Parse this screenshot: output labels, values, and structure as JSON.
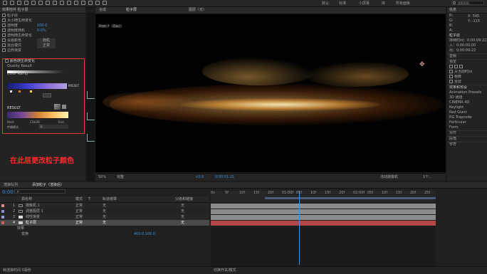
{
  "toolbar": {
    "right_items": [
      "默认",
      "标准",
      "小屏幕",
      "库",
      "所有面板"
    ],
    "search_placeholder": "搜索帮助"
  },
  "effect_panel": {
    "tab": "效果控件 粒子层",
    "rows": [
      "粒子层",
      "大小随生命变化",
      "透明度",
      "透明度随机",
      "透明随生命变化",
      "设置颜色",
      "混合模式",
      "边界渐变",
      "颜色随生命变化",
      "传输模式"
    ],
    "values": [
      "",
      "",
      "100.0",
      "0.0%",
      "",
      "随机",
      "正常",
      "",
      "",
      ""
    ],
    "group_title": "颜色随生命变化",
    "quality_label": "Quality Result",
    "color_ramp_label": "Color Ramp",
    "preset_label": "PRESET",
    "result_label": "RESULT",
    "start_label": "Start",
    "color_label": "COLOR",
    "end_label": "End",
    "mode_label": "传输模式",
    "mode_value": "无"
  },
  "annotation": {
    "text": "在此层更改粒子颜色"
  },
  "viewer": {
    "tabs": [
      "合成",
      "粒子层",
      "图层（无）"
    ],
    "comp_name": "添加粒子（渲染后）",
    "status_items": [
      "50%",
      "完整",
      "0:00:01:21",
      "活动摄像机",
      "1个...",
      "+0.0"
    ],
    "colors": {
      "glow": "#ffb347",
      "core": "#fff1b8",
      "bg": "#020202"
    }
  },
  "right_panel": {
    "title": "信息",
    "items": [
      "R:",
      "G:",
      "B:",
      "A:",
      "X: 595",
      "Y: -115",
      "粒子层",
      "持续时间：0:00:09:22",
      "入：0:00:00:00",
      "出：0:00:09:22",
      "音频",
      "预览",
      "效果和预设",
      "对齐",
      "段落",
      "字符"
    ],
    "checkbox_labels": [
      "从当前时间",
      "帧数",
      "全屏"
    ],
    "effects": [
      "Animation Presets",
      "3D 通道",
      "CINEMA 4D",
      "Keylight",
      "Red Giant",
      "RG Trapcode",
      "Particular",
      "Form"
    ]
  },
  "timeline": {
    "tabs": [
      "渲染队列",
      "添加粒子（渲染后）"
    ],
    "timecode": "0:00:01:21",
    "search_placeholder": "ρ.",
    "headers": [
      "源名称",
      "模式",
      "T",
      "轨道遮罩",
      "父级和链接"
    ],
    "ruler": [
      "0s",
      "5f",
      "10f",
      "15f",
      "20f",
      "01:00f",
      "05f",
      "10f",
      "15f",
      "20f",
      "02:00f",
      "05f",
      "10f",
      "15f",
      "20f",
      "25f"
    ],
    "layers": [
      {
        "num": "1",
        "name": "摄像机 1",
        "mode": "正常",
        "track": "无",
        "parent": "无",
        "color": "#e08a8a"
      },
      {
        "num": "2",
        "name": "调整图层 1",
        "mode": "正常",
        "track": "无",
        "parent": "无",
        "color": "#8a8ad0"
      },
      {
        "num": "3",
        "name": "线性渐变",
        "mode": "正常",
        "track": "无",
        "parent": "无",
        "color": "#9a9ad8"
      },
      {
        "num": "4",
        "name": "粒子层",
        "mode": "正常",
        "track": "无",
        "parent": "无",
        "color": "#d06060"
      }
    ],
    "sublayer": [
      "效果",
      "变换"
    ],
    "position_value": "400.0,100.0",
    "footer": "帧渲染时间 0毫秒",
    "footer_right": "切换开关/模式"
  }
}
